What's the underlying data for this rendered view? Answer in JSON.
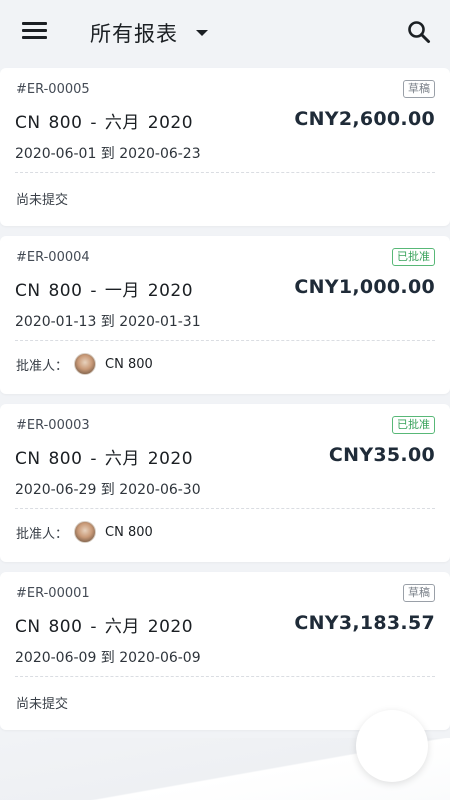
{
  "header": {
    "title": "所有报表"
  },
  "reports": [
    {
      "id": "#ER-00005",
      "status_badge": "草稿",
      "name": "CN 800 -  六月  2020",
      "amount": "CNY2,600.00",
      "dates": "2020-06-01 到 2020-06-23",
      "footer": "尚未提交"
    },
    {
      "id": "#ER-00004",
      "status_badge": "已批准",
      "name": "CN 800 -  一月  2020",
      "amount": "CNY1,000.00",
      "dates": "2020-01-13 到 2020-01-31",
      "approver_label": "批准人：",
      "approver_name": "CN 800"
    },
    {
      "id": "#ER-00003",
      "status_badge": "已批准",
      "name": "CN 800 -  六月  2020",
      "amount": "CNY35.00",
      "dates": "2020-06-29 到 2020-06-30",
      "approver_label": "批准人：",
      "approver_name": "CN 800"
    },
    {
      "id": "#ER-00001",
      "status_badge": "草稿",
      "name": "CN 800 -  六月  2020",
      "amount": "CNY3,183.57",
      "dates": "2020-06-09 到 2020-06-09",
      "footer": "尚未提交"
    }
  ],
  "colors": {
    "background": "#f1f3f6",
    "approved": "#3aa35c",
    "draft": "#7a8089"
  },
  "icons": {
    "menu": "hamburger-menu-icon",
    "dropdown": "caret-down-icon",
    "search": "search-icon"
  }
}
